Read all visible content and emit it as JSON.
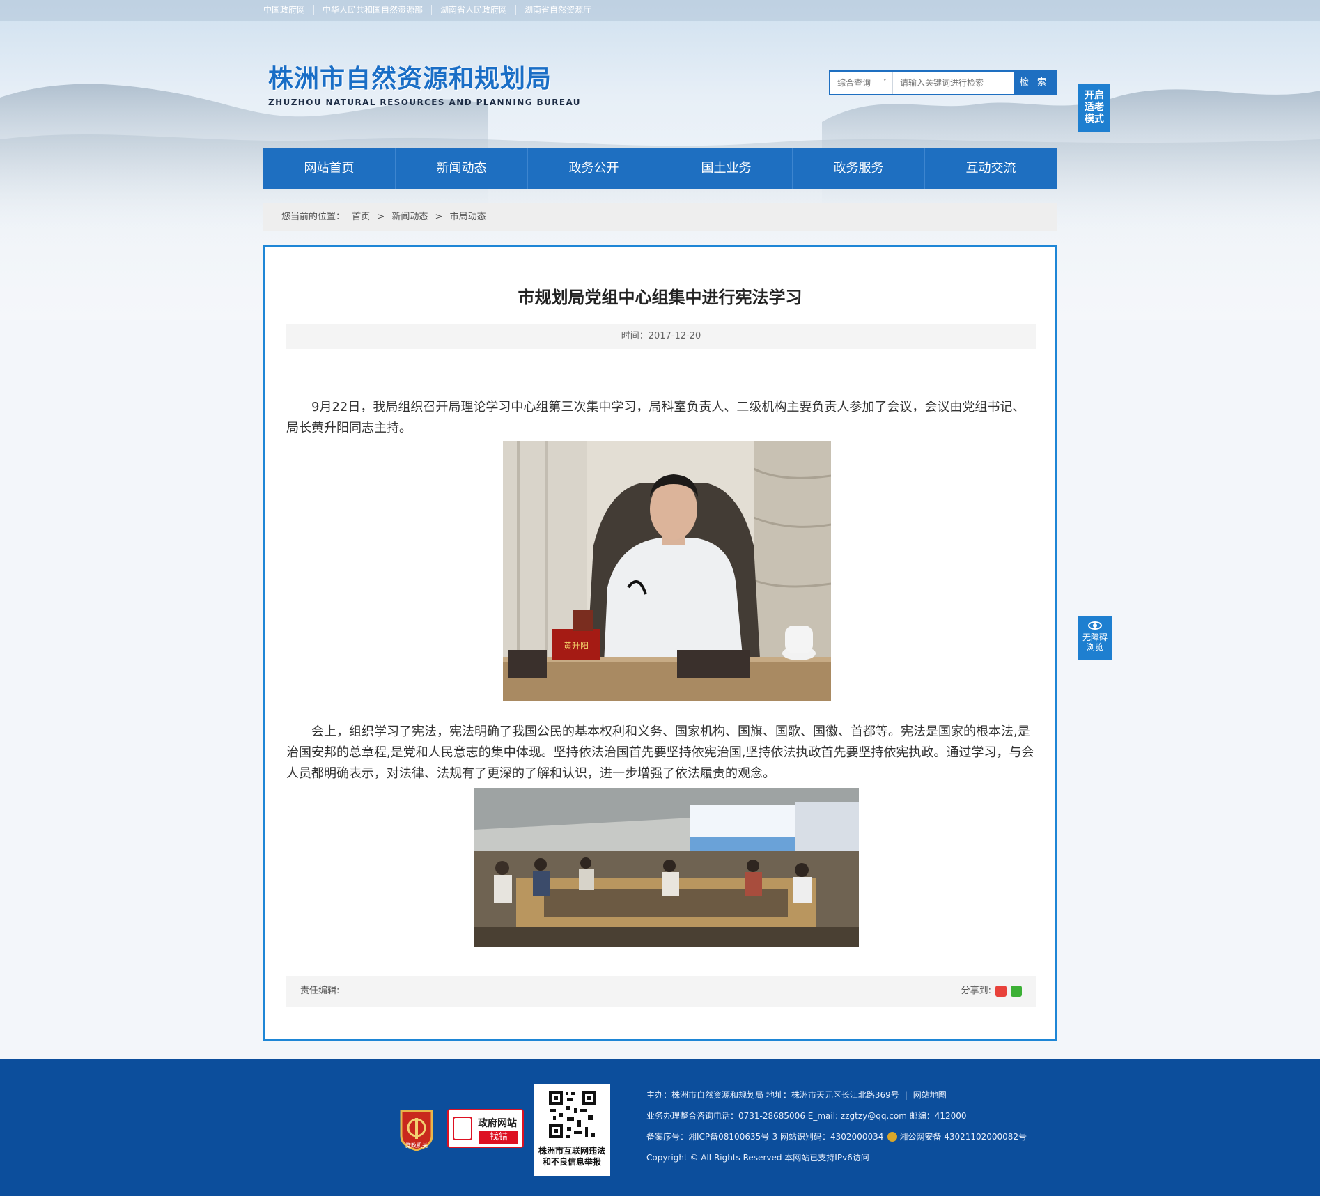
{
  "top_links": [
    "中国政府网",
    "中华人民共和国自然资源部",
    "湖南省人民政府网",
    "湖南省自然资源厅"
  ],
  "logo": {
    "cn": "株洲市自然资源和规划局",
    "en": "ZHUZHOU NATURAL RESOURCES AND PLANNING BUREAU"
  },
  "search": {
    "select_value": "综合查询",
    "placeholder": "请输入关键词进行检索",
    "button": "检 索"
  },
  "elder_mode": [
    "开启",
    "适老",
    "模式"
  ],
  "accessibility": [
    "无障碍",
    "浏览"
  ],
  "nav": [
    "网站首页",
    "新闻动态",
    "政务公开",
    "国土业务",
    "政务服务",
    "互动交流"
  ],
  "breadcrumb": {
    "label": "您当前的位置：",
    "items": [
      "首页",
      ">",
      "新闻动态",
      ">",
      "市局动态"
    ]
  },
  "article": {
    "title": "市规划局党组中心组集中进行宪法学习",
    "time": "时间：2017-12-20",
    "p1": "9月22日，我局组织召开局理论学习中心组第三次集中学习，局科室负责人、二级机构主要负责人参加了会议，会议由党组书记、局长黄升阳同志主持。",
    "p2": "会上，组织学习了宪法，宪法明确了我国公民的基本权利和义务、国家机构、国旗、国歌、国徽、首都等。宪法是国家的根本法,是治国安邦的总章程,是党和人民意志的集中体现。坚持依法治国首先要坚持依宪治国,坚持依法执政首先要坚持依宪执政。通过学习，与会人员都明确表示，对法律、法规有了更深的了解和认识，进一步增强了依法履责的观念。",
    "nameplate": "黄升阳",
    "editor": "责任编辑:",
    "share_label": "分享到:"
  },
  "footer": {
    "badge_party": "党政机关",
    "badge_error": [
      "政府网站",
      "找错"
    ],
    "qr_caption": [
      "株洲市互联网违法",
      "和不良信息举报"
    ],
    "line1": "主办：株洲市自然资源和规划局  地址：株洲市天元区长江北路369号",
    "line1_link": "网站地图",
    "line2": "业务办理整合咨询电话：0731-28685006   E_mail:   zzgtzy@qq.com    邮编：412000",
    "line3a": "备案序号：湘ICP备08100635号-3 网站识别码：4302000034",
    "line3b": "湘公网安备 43021102000082号",
    "line4": "Copyright © All Rights Reserved 本网站已支持IPv6访问"
  },
  "colors": {
    "primary": "#1e6fc1",
    "frame": "#1e86d6",
    "footer": "#0c4e9c"
  }
}
